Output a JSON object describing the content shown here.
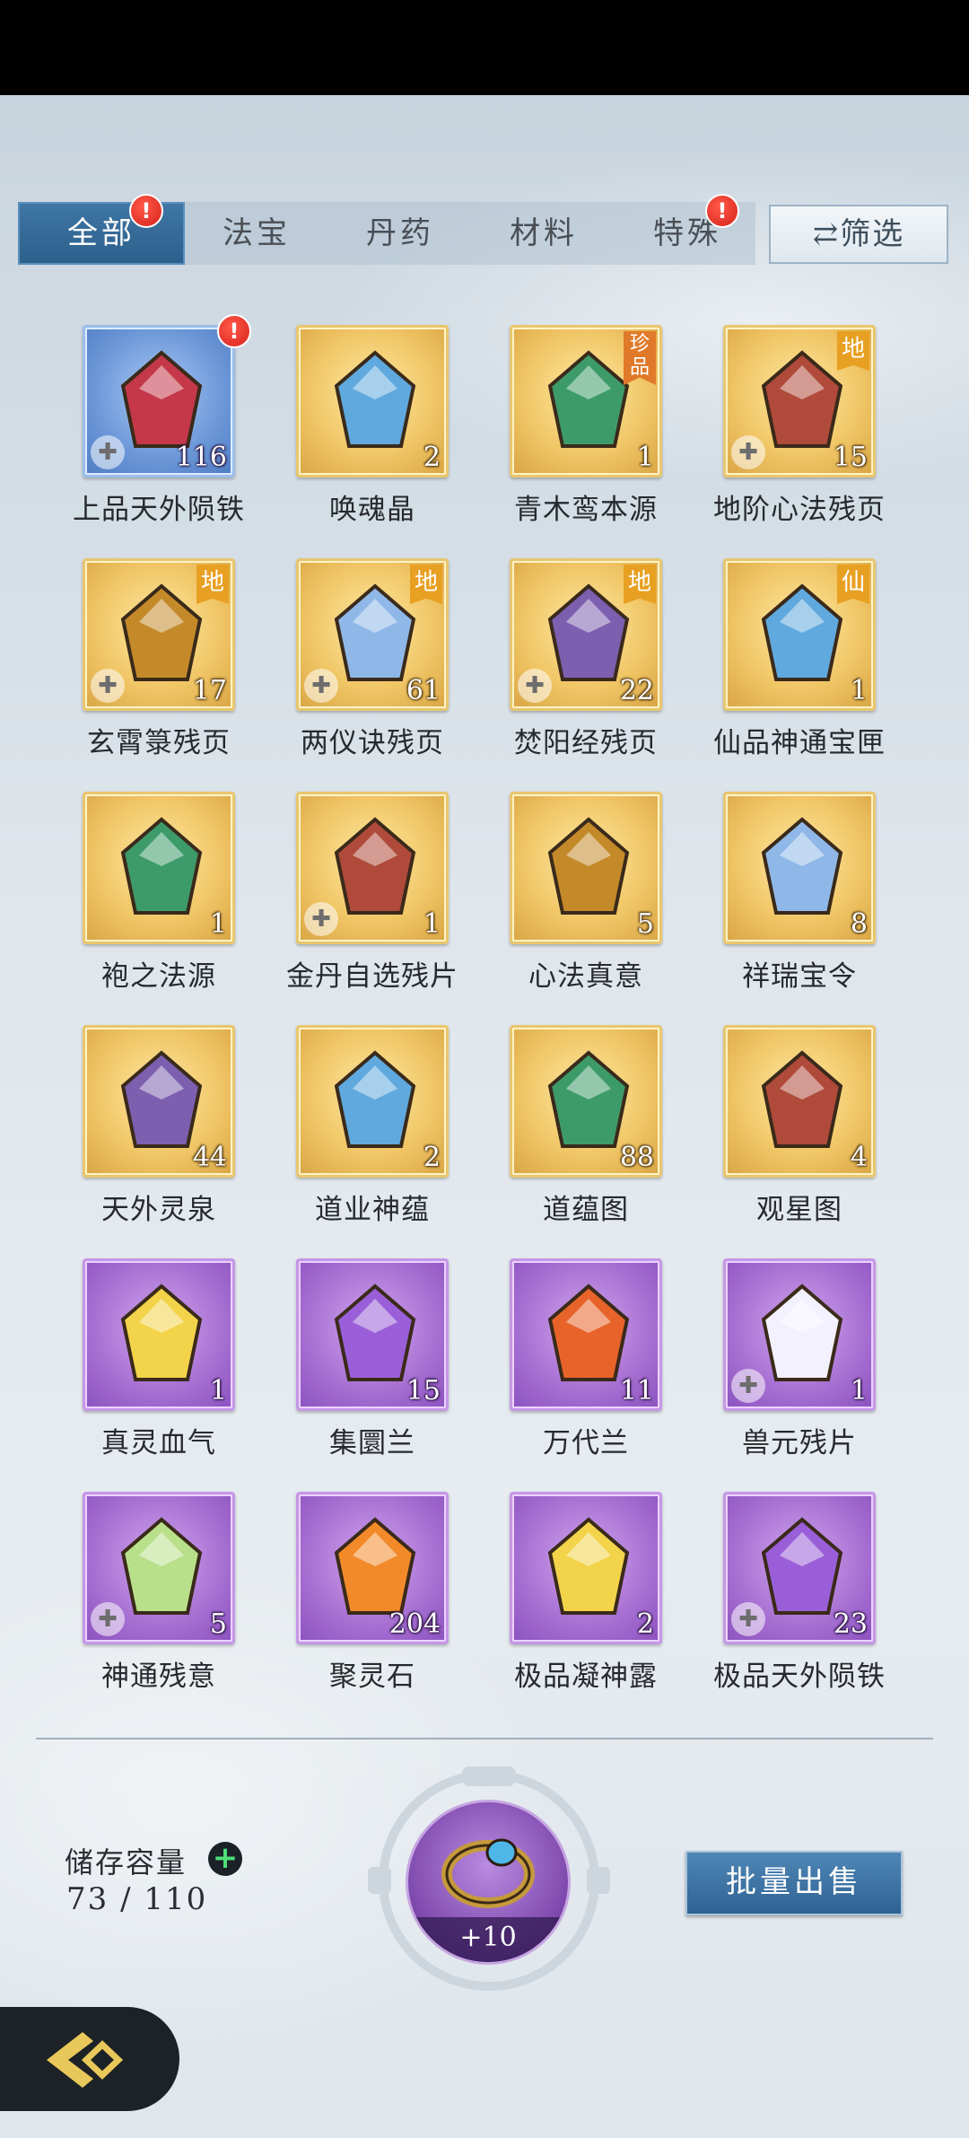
{
  "tabs": [
    {
      "label": "全部",
      "active": true,
      "badge": "!"
    },
    {
      "label": "法宝",
      "active": false
    },
    {
      "label": "丹药",
      "active": false
    },
    {
      "label": "材料",
      "active": false
    },
    {
      "label": "特殊",
      "active": false,
      "badge": "!"
    }
  ],
  "filter": {
    "label": "⇄筛选"
  },
  "items": [
    {
      "name": "上品天外陨铁",
      "count": "116",
      "frame": "blue",
      "badge": "!"
    },
    {
      "name": "唤魂晶",
      "count": "2",
      "frame": "gold"
    },
    {
      "name": "青木鸾本源",
      "count": "1",
      "frame": "gold",
      "grade": "珍品"
    },
    {
      "name": "地阶心法残页",
      "count": "15",
      "frame": "gold",
      "grade": "地"
    },
    {
      "name": "玄霄箓残页",
      "count": "17",
      "frame": "gold",
      "grade": "地"
    },
    {
      "name": "两仪诀残页",
      "count": "61",
      "frame": "gold",
      "grade": "地"
    },
    {
      "name": "焚阳经残页",
      "count": "22",
      "frame": "gold",
      "grade": "地"
    },
    {
      "name": "仙品神通宝匣",
      "count": "1",
      "frame": "gold",
      "grade": "仙"
    },
    {
      "name": "袍之法源",
      "count": "1",
      "frame": "gold"
    },
    {
      "name": "金丹自选残片",
      "count": "1",
      "frame": "gold"
    },
    {
      "name": "心法真意",
      "count": "5",
      "frame": "gold"
    },
    {
      "name": "祥瑞宝令",
      "count": "8",
      "frame": "gold"
    },
    {
      "name": "天外灵泉",
      "count": "44",
      "frame": "gold"
    },
    {
      "name": "道业神蕴",
      "count": "2",
      "frame": "gold"
    },
    {
      "name": "道蕴图",
      "count": "88",
      "frame": "gold"
    },
    {
      "name": "观星图",
      "count": "4",
      "frame": "gold"
    },
    {
      "name": "真灵血气",
      "count": "1",
      "frame": "purple"
    },
    {
      "name": "集圜兰",
      "count": "15",
      "frame": "purple"
    },
    {
      "name": "万代兰",
      "count": "11",
      "frame": "purple"
    },
    {
      "name": "兽元残片",
      "count": "1",
      "frame": "purple"
    },
    {
      "name": "神通残意",
      "count": "5",
      "frame": "purple"
    },
    {
      "name": "聚灵石",
      "count": "204",
      "frame": "purple"
    },
    {
      "name": "极品凝神露",
      "count": "2",
      "frame": "purple"
    },
    {
      "name": "极品天外陨铁",
      "count": "23",
      "frame": "purple"
    }
  ],
  "storage": {
    "label": "储存容量",
    "value": "73 / 110",
    "plus": "+"
  },
  "equipped_ring": {
    "level": "+10"
  },
  "bulk_sell": {
    "label": "批量出售"
  },
  "colors": {
    "tab_active": "#2d5f8b",
    "gold_frame": "#f1c767",
    "purple_frame": "#a66fd2",
    "blue_frame": "#6b97d8",
    "badge_red": "#d8201a"
  }
}
